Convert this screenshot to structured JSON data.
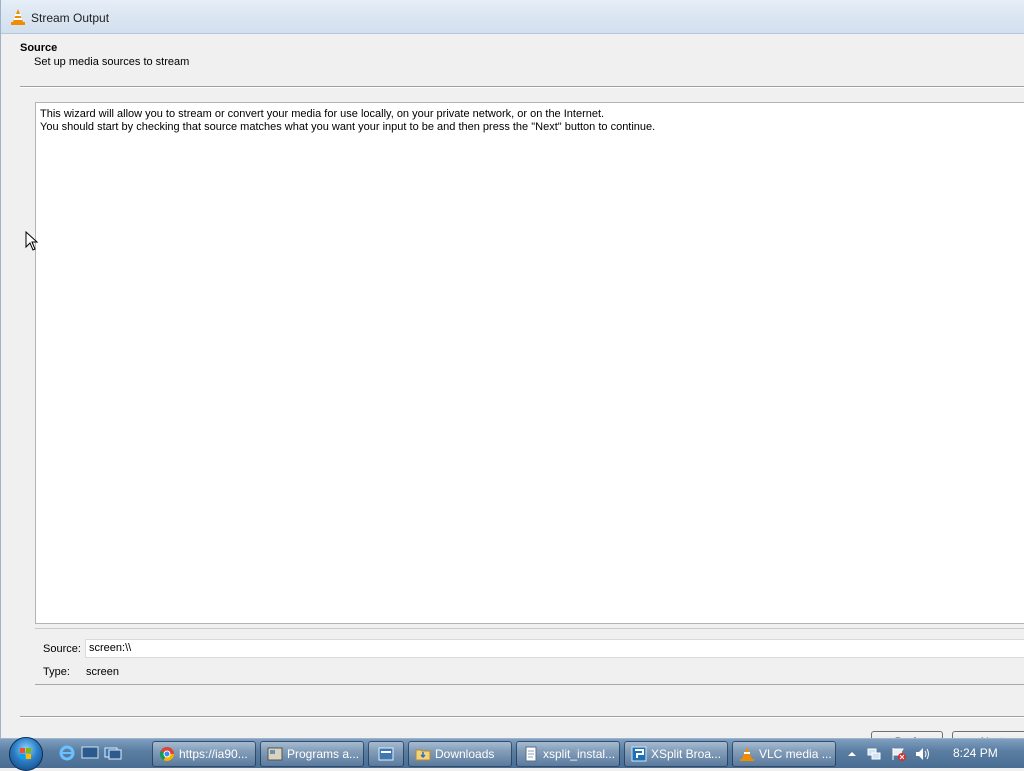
{
  "window": {
    "title": "Stream Output"
  },
  "header": {
    "title": "Source",
    "subtitle": "Set up media sources to stream"
  },
  "description": {
    "line1": "This wizard will allow you to stream or convert your media for use locally, on your private network, or on the Internet.",
    "line2": "You should start by checking that source matches what you want your input to be and then press the \"Next\" button to continue."
  },
  "source": {
    "label": "Source:",
    "value": "screen:\\\\",
    "type_label": "Type:",
    "type_value": "screen"
  },
  "buttons": {
    "back": "Back",
    "next": "Next"
  },
  "taskbar": {
    "tasks": [
      {
        "label": "https://ia90...",
        "icon": "chrome-icon"
      },
      {
        "label": "Programs a...",
        "icon": "control-panel-icon"
      },
      {
        "label": "",
        "icon": "app-icon"
      },
      {
        "label": "Downloads",
        "icon": "folder-icon"
      },
      {
        "label": "xsplit_instal...",
        "icon": "notepad-icon"
      },
      {
        "label": "XSplit Broa...",
        "icon": "xsplit-icon"
      },
      {
        "label": "VLC media ...",
        "icon": "vlc-icon"
      }
    ],
    "clock": "8:24 PM"
  },
  "colors": {
    "accent": "#4a6d93",
    "vlc_orange": "#f08c00"
  }
}
